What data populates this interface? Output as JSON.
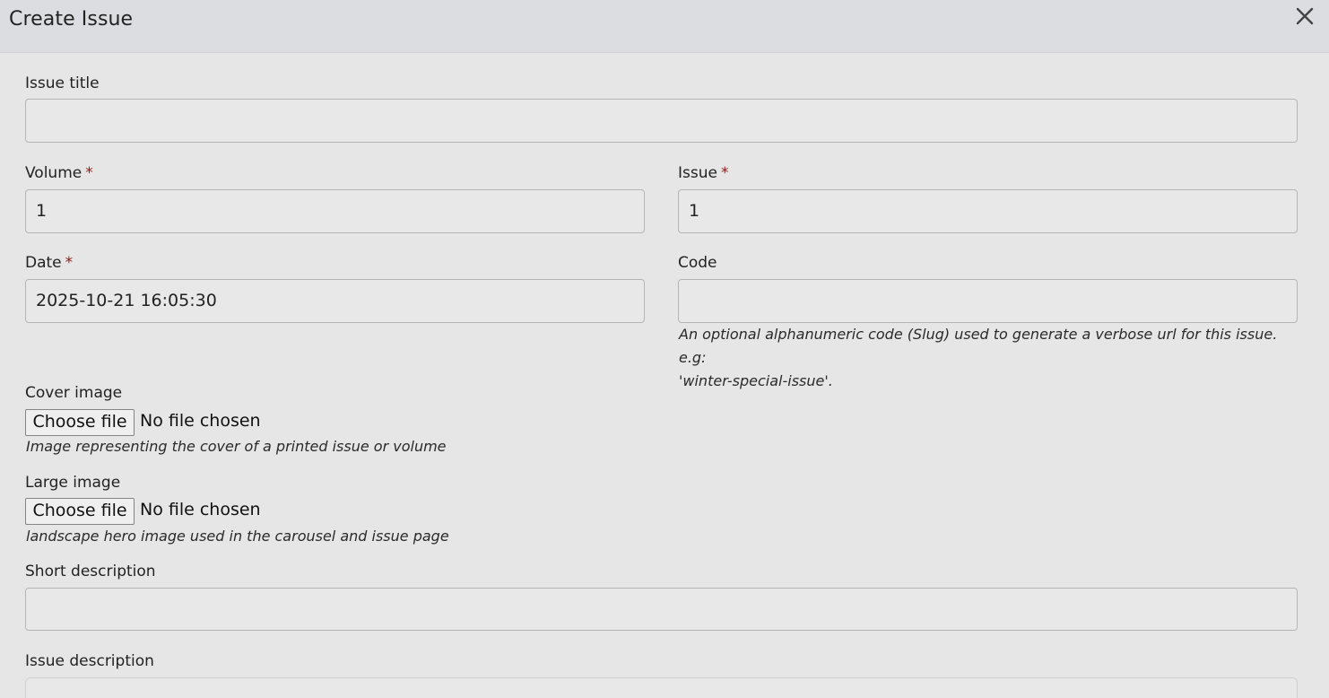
{
  "header": {
    "title": "Create Issue",
    "close_icon": "close-icon"
  },
  "form": {
    "issue_title": {
      "label": "Issue title",
      "value": ""
    },
    "volume": {
      "label": "Volume",
      "required_mark": "*",
      "value": "1"
    },
    "issue": {
      "label": "Issue",
      "required_mark": "*",
      "value": "1"
    },
    "date": {
      "label": "Date",
      "required_mark": "*",
      "value": "2025-10-21 16:05:30"
    },
    "code": {
      "label": "Code",
      "value": "",
      "help_line1": "An optional alphanumeric code (Slug) used to generate a verbose url for this issue. e.g:",
      "help_line2": "'winter-special-issue'."
    },
    "cover_image": {
      "label": "Cover image",
      "button": "Choose file",
      "status": "No file chosen",
      "help": "Image representing the cover of a printed issue or volume"
    },
    "large_image": {
      "label": "Large image",
      "button": "Choose file",
      "status": "No file chosen",
      "help": "landscape hero image used in the carousel and issue page"
    },
    "short_description": {
      "label": "Short description",
      "value": ""
    },
    "issue_description": {
      "label": "Issue description",
      "value": ""
    }
  },
  "colors": {
    "header_bg": "#dcdde1",
    "body_bg": "#e6e6e6",
    "required_mark": "#8b1a1a"
  }
}
